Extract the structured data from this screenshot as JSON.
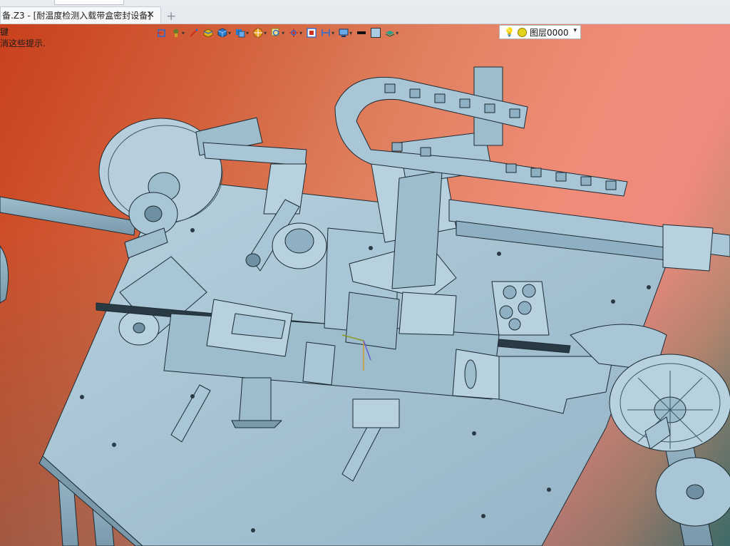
{
  "window": {
    "tab_title": "备.Z3 - [耐温度检测入载带盒密封设备]",
    "close_glyph": "✕",
    "add_tab_glyph": "+"
  },
  "hint": {
    "line1": "键",
    "line2": "消这些提示."
  },
  "toolbar": {
    "layer_label": "图层0000",
    "layer_caret": "▾",
    "buttons": [
      {
        "icon": "snap-icon",
        "color": "#2a6bd1"
      },
      {
        "icon": "filter-icon",
        "color": "#6a7a2a"
      },
      {
        "icon": "pen-icon",
        "color": "#d03020"
      },
      {
        "icon": "solid-block-icon",
        "color": "#d0a020"
      },
      {
        "icon": "shaded-cube-icon",
        "color": "#2a7ad0"
      },
      {
        "icon": "views-icon",
        "color": "#2a7ad0"
      },
      {
        "icon": "render-mode-icon",
        "color": "#e08a10"
      },
      {
        "icon": "zoom-icon",
        "color": "#d0a020"
      },
      {
        "icon": "rotate-icon",
        "color": "#d03020"
      },
      {
        "icon": "section-icon",
        "color": "#2a6bd1"
      },
      {
        "icon": "dimension-icon",
        "color": "#2a6bd1"
      },
      {
        "icon": "display-icon",
        "color": "#2a6bd1"
      },
      {
        "icon": "line-weight-icon",
        "color": "#111111"
      },
      {
        "icon": "color-swatch-icon",
        "color": "#a9cce3"
      },
      {
        "icon": "layer-manager-icon",
        "color": "#2aa08a"
      }
    ]
  },
  "colors": {
    "part_fill": "#a9c6d6",
    "part_shade": "#8fb0c2",
    "part_dark": "#6f90a2",
    "edge": "#1b2a33"
  }
}
